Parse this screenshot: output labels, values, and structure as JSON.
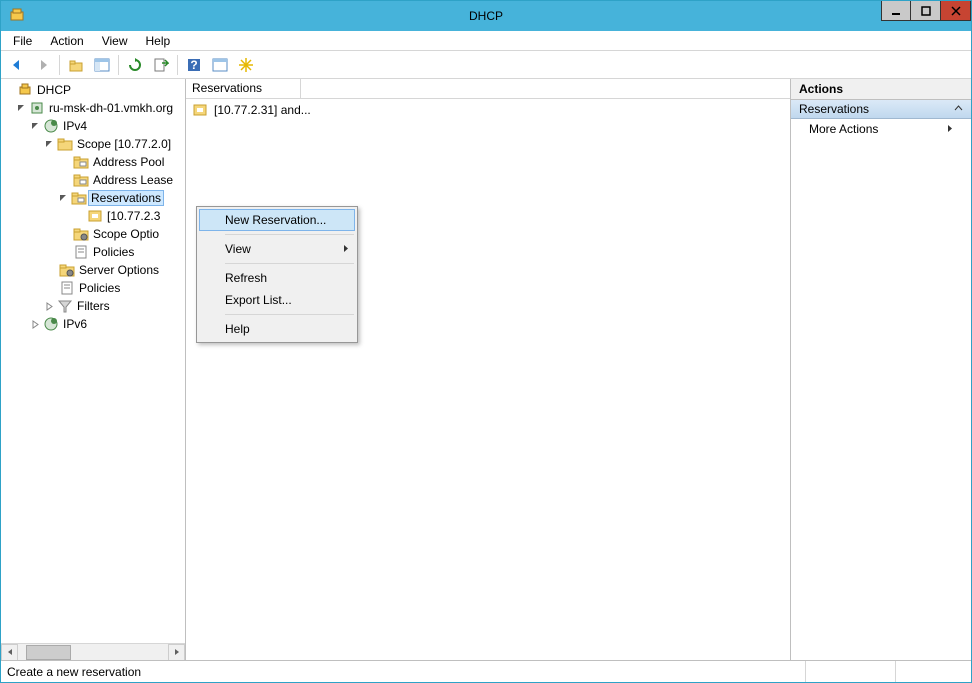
{
  "title": "DHCP",
  "menubar": [
    "File",
    "Action",
    "View",
    "Help"
  ],
  "tree": {
    "root": "DHCP",
    "server": "ru-msk-dh-01.vmkh.org",
    "ipv4": "IPv4",
    "scope": "Scope [10.77.2.0]",
    "address_pool": "Address Pool",
    "address_leases": "Address Lease",
    "reservations": "Reservations",
    "reservation_item": "[10.77.2.3",
    "scope_options": "Scope Optio",
    "policies": "Policies",
    "server_options": "Server Options",
    "server_policies": "Policies",
    "filters": "Filters",
    "ipv6": "IPv6"
  },
  "list": {
    "header": "Reservations",
    "items": [
      "[10.77.2.31] and..."
    ]
  },
  "actions": {
    "title": "Actions",
    "section": "Reservations",
    "items": [
      "More Actions"
    ]
  },
  "context_menu": {
    "new_reservation": "New Reservation...",
    "view": "View",
    "refresh": "Refresh",
    "export_list": "Export List...",
    "help": "Help"
  },
  "status": "Create a new reservation"
}
